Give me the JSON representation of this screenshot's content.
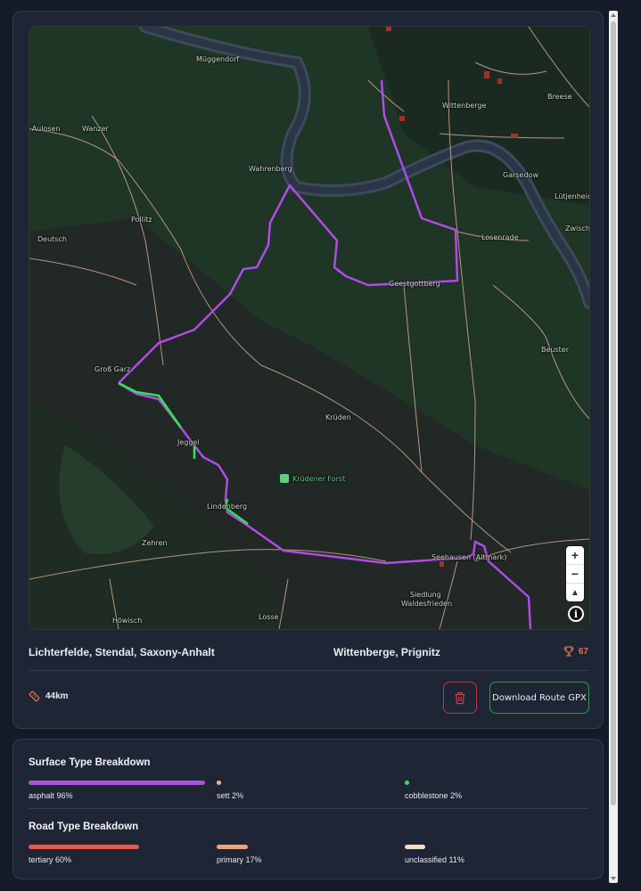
{
  "map": {
    "places": [
      {
        "name": "Müggendorf",
        "id": "muggendorf"
      },
      {
        "name": "Wittenberge",
        "id": "wittenberge"
      },
      {
        "name": "Breese",
        "id": "breese"
      },
      {
        "name": "-Aulosen",
        "id": "aulosen"
      },
      {
        "name": "Wanzer",
        "id": "wanzer"
      },
      {
        "name": "Garsedow",
        "id": "garsedow"
      },
      {
        "name": "Wahrenberg",
        "id": "wahrenberg"
      },
      {
        "name": "Lütjenheid",
        "id": "lutjenheid"
      },
      {
        "name": "Pollitz",
        "id": "pollitz"
      },
      {
        "name": "Zwisch",
        "id": "zwisch"
      },
      {
        "name": "Losenrade",
        "id": "losenrade"
      },
      {
        "name": "Deutsch",
        "id": "deutsch"
      },
      {
        "name": "Geestgottberg",
        "id": "geestgottberg"
      },
      {
        "name": "Beuster",
        "id": "beuster"
      },
      {
        "name": "Groß Garz",
        "id": "gross-garz"
      },
      {
        "name": "Krüden",
        "id": "kruden"
      },
      {
        "name": "Jeggel",
        "id": "jeggel"
      },
      {
        "name": "Krüdener Forst",
        "id": "krudener-forst"
      },
      {
        "name": "Lindenberg",
        "id": "lindenberg"
      },
      {
        "name": "Zehren",
        "id": "zehren"
      },
      {
        "name": "Seehausen (Altmark)",
        "id": "seehausen"
      },
      {
        "name": "Siedlung",
        "id": "siedlung"
      },
      {
        "name": "Waldesfrieden",
        "id": "waldesfrieden"
      },
      {
        "name": "Höwisch",
        "id": "howisch"
      },
      {
        "name": "Losse",
        "id": "losse"
      }
    ],
    "zoom_in": "+",
    "zoom_out": "−",
    "compass": "▲",
    "info": "i",
    "colors": {
      "route_main": "#b04be8",
      "route_cobble": "#2ee64f",
      "roads": "#e8b9a2",
      "river": "#3c4a5a"
    }
  },
  "route": {
    "start": "Lichterfelde, Stendal, Saxony-Anhalt",
    "end": "Wittenberge, Prignitz",
    "score": "67",
    "distance": "44km",
    "download_label": "Download Route GPX"
  },
  "surface": {
    "title": "Surface Type Breakdown",
    "items": [
      {
        "label": "asphalt 96%",
        "color": "#a755d6",
        "fraction": 0.96
      },
      {
        "label": "sett 2%",
        "color": "#f0b38f",
        "fraction": 0.02
      },
      {
        "label": "cobblestone 2%",
        "color": "#2ee64f",
        "fraction": 0.02
      }
    ]
  },
  "road": {
    "title": "Road Type Breakdown",
    "items": [
      {
        "label": "tertiary 60%",
        "color": "#e85a4a",
        "fraction": 0.6
      },
      {
        "label": "primary 17%",
        "color": "#f0a27f",
        "fraction": 0.17
      },
      {
        "label": "unclassified 11%",
        "color": "#f7dccb",
        "fraction": 0.11
      }
    ]
  }
}
